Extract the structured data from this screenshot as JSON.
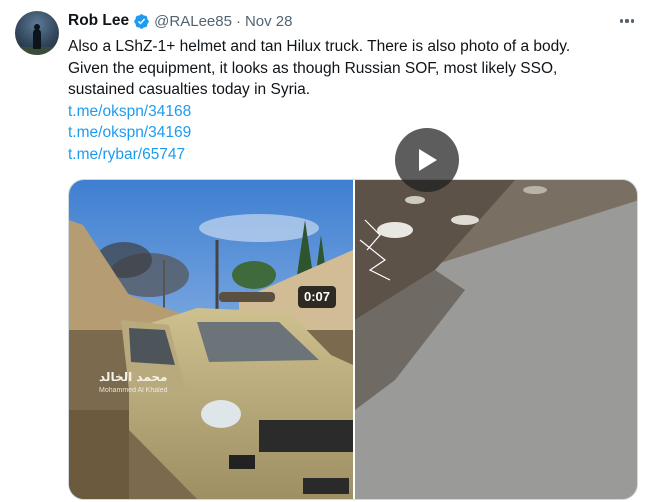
{
  "tweet": {
    "author_name": "Rob Lee",
    "handle": "@RALee85",
    "separator": "·",
    "date": "Nov 28",
    "text_lines": [
      "Also a LShZ-1+ helmet and tan Hilux truck. There is also photo of a body.",
      "Given the equipment, it looks as though Russian SOF, most likely SSO,",
      "sustained casualties today in Syria."
    ],
    "links": [
      "t.me/okspn/34168",
      "t.me/okspn/34169",
      "t.me/rybar/65747"
    ]
  },
  "media": {
    "photo_watermark_arabic": "محمد الخالد",
    "photo_watermark_latin": "Mohammed Al Khaled",
    "video_duration": "0:07"
  },
  "icons": {
    "verified": "verified-badge-icon",
    "more": "more-options-icon",
    "play": "play-icon"
  },
  "colors": {
    "link": "#1d9bf0",
    "verified": "#1d9bf0",
    "secondary_text": "#536471"
  }
}
